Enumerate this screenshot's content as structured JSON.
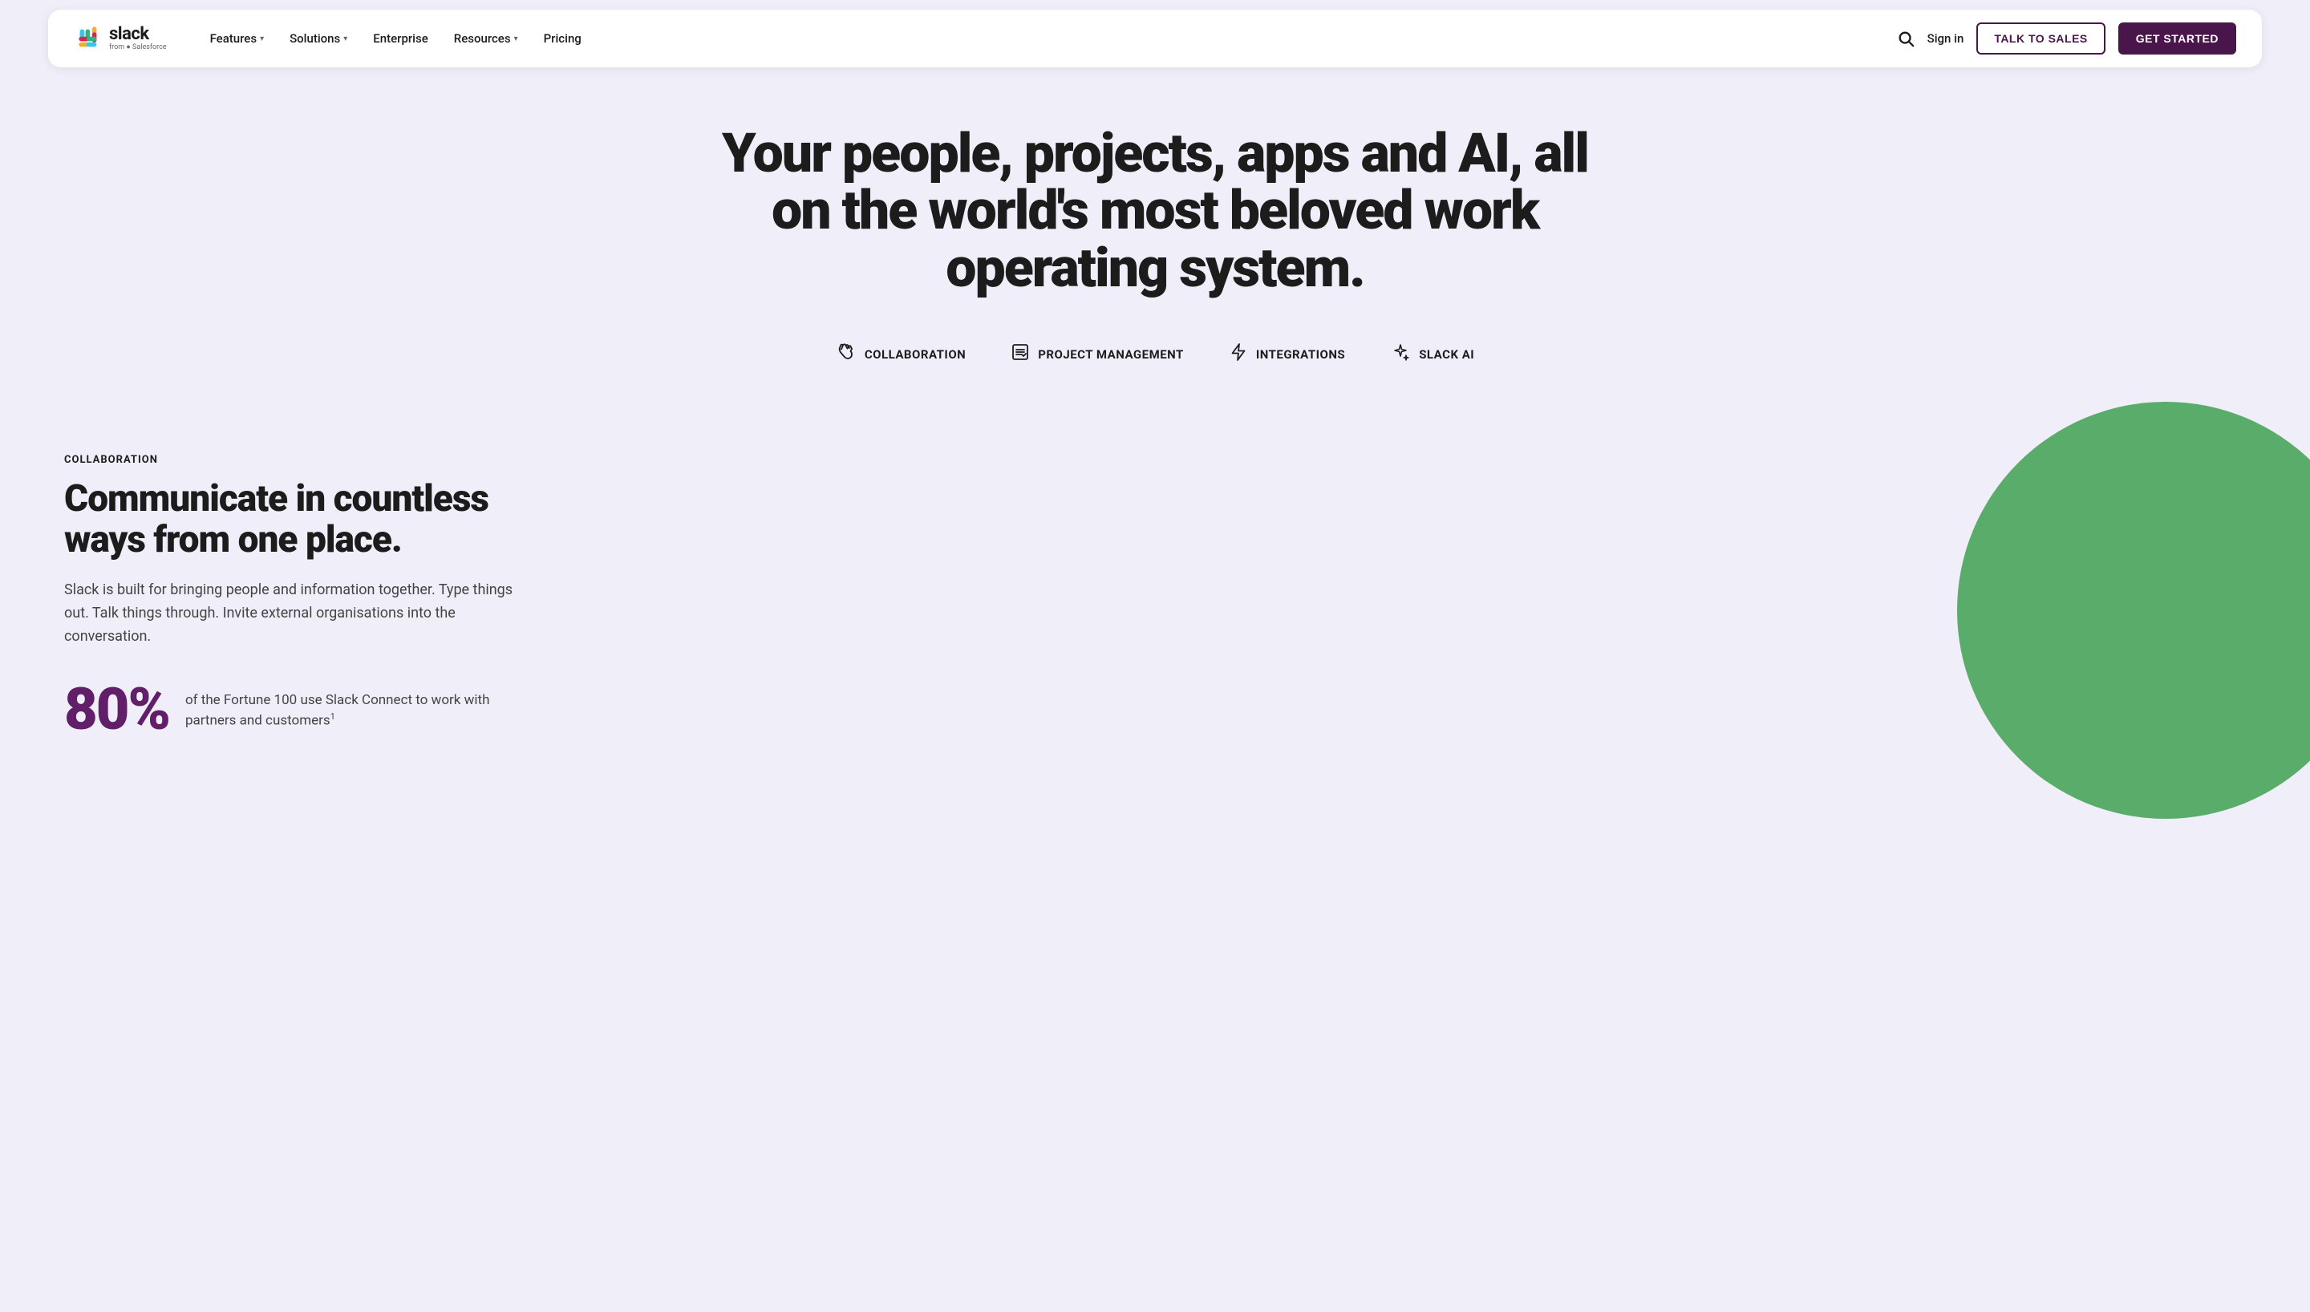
{
  "nav": {
    "logo_text": "slack",
    "logo_sub": "from ⬤ Salesforce",
    "links": [
      {
        "label": "Features",
        "has_dropdown": true
      },
      {
        "label": "Solutions",
        "has_dropdown": true
      },
      {
        "label": "Enterprise",
        "has_dropdown": false
      },
      {
        "label": "Resources",
        "has_dropdown": true
      },
      {
        "label": "Pricing",
        "has_dropdown": false
      }
    ],
    "search_label": "Search",
    "signin_label": "Sign in",
    "talk_to_sales": "TALK TO SALES",
    "get_started": "GET STARTED"
  },
  "hero": {
    "title": "Your people, projects, apps and AI, all on the world's most beloved work operating system."
  },
  "feature_tabs": [
    {
      "id": "collaboration",
      "icon": "🤝",
      "label": "COLLABORATION"
    },
    {
      "id": "project-management",
      "icon": "📋",
      "label": "PROJECT MANAGEMENT"
    },
    {
      "id": "integrations",
      "icon": "⚡",
      "label": "INTEGRATIONS"
    },
    {
      "id": "slack-ai",
      "icon": "✦",
      "label": "SLACK AI"
    }
  ],
  "collaboration_section": {
    "badge": "COLLABORATION",
    "title": "Communicate in countless ways from one place.",
    "description": "Slack is built for bringing people and information together. Type things out. Talk things through. Invite external organisations into the conversation.",
    "stat_number": "80%",
    "stat_text": "of the Fortune 100 use Slack Connect to work with partners and customers",
    "stat_superscript": "1"
  }
}
